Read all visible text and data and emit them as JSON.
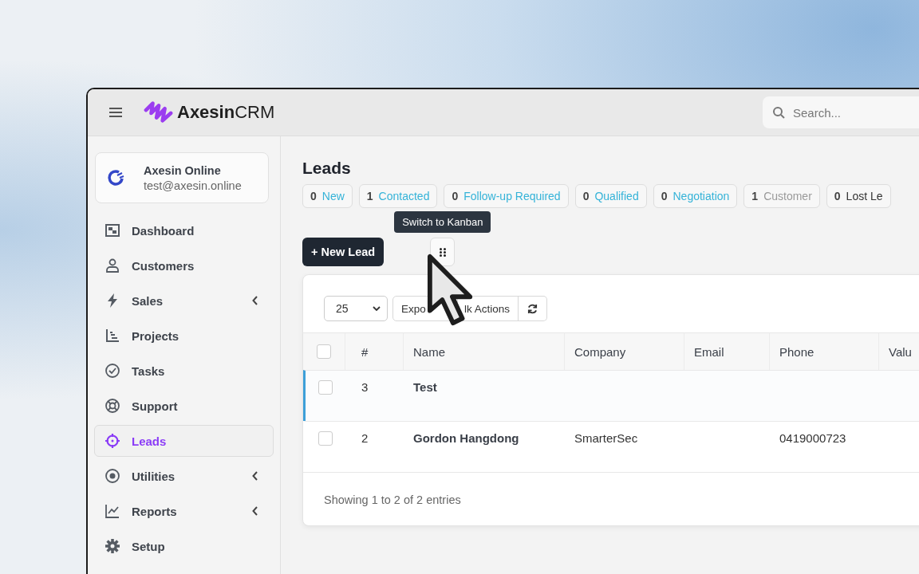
{
  "header": {
    "brand_bold": "Axesin",
    "brand_light": "CRM",
    "search": {
      "placeholder": "Search..."
    }
  },
  "account": {
    "name": "Axesin Online",
    "email": "test@axesin.online"
  },
  "sidebar": {
    "items": [
      {
        "label": "Dashboard",
        "kind": "dashboard",
        "expandable": false,
        "selected": false
      },
      {
        "label": "Customers",
        "kind": "user",
        "expandable": false,
        "selected": false
      },
      {
        "label": "Sales",
        "kind": "bolt",
        "expandable": true,
        "selected": false
      },
      {
        "label": "Projects",
        "kind": "projects",
        "expandable": false,
        "selected": false
      },
      {
        "label": "Tasks",
        "kind": "check",
        "expandable": false,
        "selected": false
      },
      {
        "label": "Support",
        "kind": "lifebuoy",
        "expandable": false,
        "selected": false
      },
      {
        "label": "Leads",
        "kind": "target",
        "expandable": false,
        "selected": true
      },
      {
        "label": "Utilities",
        "kind": "radio",
        "expandable": true,
        "selected": false
      },
      {
        "label": "Reports",
        "kind": "chart",
        "expandable": true,
        "selected": false
      },
      {
        "label": "Setup",
        "kind": "gear",
        "expandable": false,
        "selected": false
      }
    ]
  },
  "page": {
    "title": "Leads",
    "statuses": [
      {
        "count": "0",
        "label": "New",
        "color": "#35b3d8"
      },
      {
        "count": "1",
        "label": "Contacted",
        "color": "#35b3d8"
      },
      {
        "count": "0",
        "label": "Follow-up Required",
        "color": "#35b3d8"
      },
      {
        "count": "0",
        "label": "Qualified",
        "color": "#35b3d8"
      },
      {
        "count": "0",
        "label": "Negotiation",
        "color": "#35b3d8"
      },
      {
        "count": "1",
        "label": "Customer",
        "color": "#9a9a9a"
      },
      {
        "count": "0",
        "label": "Lost Le",
        "color": "#333333"
      }
    ],
    "new_button": "+ New Lead",
    "tooltip": "Switch to Kanban"
  },
  "table": {
    "page_size": "25",
    "select_all_checked": false,
    "export_button": "Expo",
    "bulk_button": "lk Actions",
    "columns": [
      "#",
      "Name",
      "Company",
      "Email",
      "Phone",
      "Valu"
    ],
    "rows": [
      {
        "id": "3",
        "name": "Test",
        "company": "",
        "email": "",
        "phone": "",
        "checked": false,
        "selected": true
      },
      {
        "id": "2",
        "name": "Gordon Hangdong",
        "company": "SmarterSec",
        "email": "",
        "phone": "0419000723",
        "checked": false,
        "selected": false
      }
    ],
    "footer": "Showing 1 to 2 of 2 entries"
  }
}
